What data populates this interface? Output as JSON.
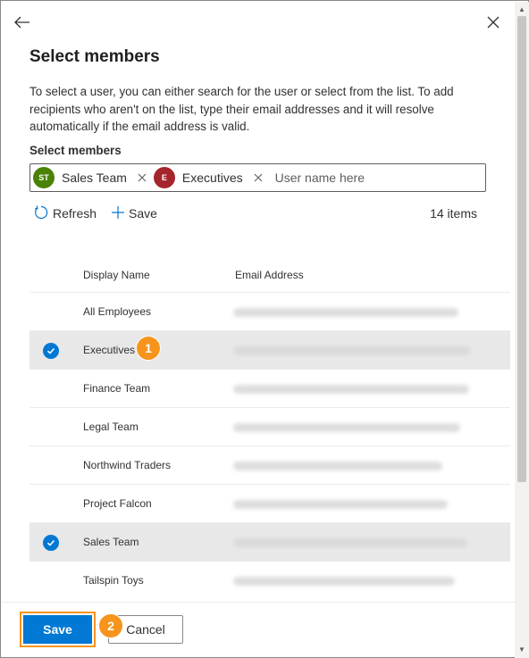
{
  "panel": {
    "title": "Select members",
    "description": "To select a user, you can either search for the user or select from the list. To add recipients who aren't on the list, type their email addresses and it will resolve automatically if the email address is valid."
  },
  "picker": {
    "label": "Select members",
    "placeholder": "User name here",
    "chips": [
      {
        "initials": "ST",
        "label": "Sales Team",
        "color": "#498205"
      },
      {
        "initials": "E",
        "label": "Executives",
        "color": "#a4262c"
      }
    ]
  },
  "toolbar": {
    "refresh_label": "Refresh",
    "save_label": "Save",
    "item_count": "14 items"
  },
  "list": {
    "columns": [
      "Display Name",
      "Email Address"
    ],
    "rows": [
      {
        "name": "All Employees",
        "selected": false
      },
      {
        "name": "Executives",
        "selected": true
      },
      {
        "name": "Finance Team",
        "selected": false
      },
      {
        "name": "Legal Team",
        "selected": false
      },
      {
        "name": "Northwind Traders",
        "selected": false
      },
      {
        "name": "Project Falcon",
        "selected": false
      },
      {
        "name": "Sales Team",
        "selected": true
      },
      {
        "name": "Tailspin Toys",
        "selected": false
      }
    ]
  },
  "callouts": {
    "step1": "1",
    "step2": "2"
  },
  "footer": {
    "save_label": "Save",
    "cancel_label": "Cancel"
  },
  "colors": {
    "accent": "#0078d4",
    "callout": "#f7941d",
    "selected_row": "#e8e8e8"
  },
  "icons": [
    "back-arrow-icon",
    "close-icon",
    "chip-remove-icon",
    "refresh-icon",
    "plus-icon",
    "checkmark-icon",
    "scroll-up-arrow-icon",
    "scroll-down-arrow-icon"
  ]
}
